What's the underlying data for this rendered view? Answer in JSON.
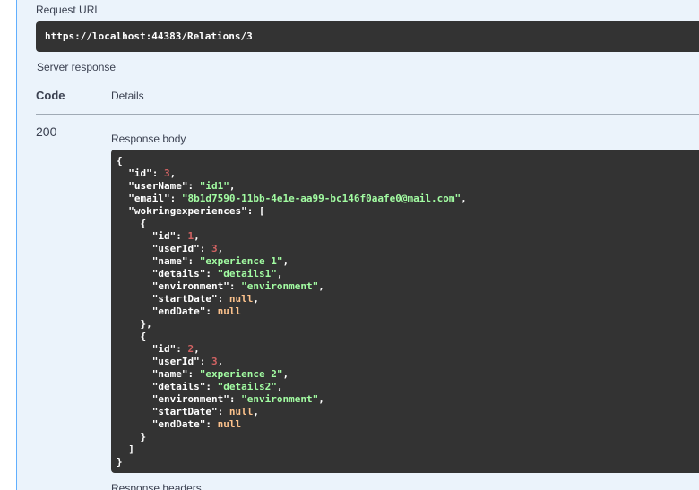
{
  "request_url": {
    "label": "Request URL",
    "value": "https://localhost:44383/Relations/3"
  },
  "server_response": {
    "label": "Server response",
    "headers": {
      "code": "Code",
      "details": "Details"
    },
    "status_code": "200",
    "response_body_label": "Response body",
    "response_headers_label": "Response headers",
    "body": [
      [
        [
          "p",
          "{"
        ]
      ],
      [
        [
          "p",
          "  "
        ],
        [
          "k",
          "\"id\""
        ],
        [
          "p",
          ": "
        ],
        [
          "n",
          "3"
        ],
        [
          "p",
          ","
        ]
      ],
      [
        [
          "p",
          "  "
        ],
        [
          "k",
          "\"userName\""
        ],
        [
          "p",
          ": "
        ],
        [
          "s",
          "\"id1\""
        ],
        [
          "p",
          ","
        ]
      ],
      [
        [
          "p",
          "  "
        ],
        [
          "k",
          "\"email\""
        ],
        [
          "p",
          ": "
        ],
        [
          "s",
          "\"8b1d7590-11bb-4e1e-aa99-bc146f0aafe0@mail.com\""
        ],
        [
          "p",
          ","
        ]
      ],
      [
        [
          "p",
          "  "
        ],
        [
          "k",
          "\"wokringexperiences\""
        ],
        [
          "p",
          ": ["
        ]
      ],
      [
        [
          "p",
          "    {"
        ]
      ],
      [
        [
          "p",
          "      "
        ],
        [
          "k",
          "\"id\""
        ],
        [
          "p",
          ": "
        ],
        [
          "n",
          "1"
        ],
        [
          "p",
          ","
        ]
      ],
      [
        [
          "p",
          "      "
        ],
        [
          "k",
          "\"userId\""
        ],
        [
          "p",
          ": "
        ],
        [
          "n",
          "3"
        ],
        [
          "p",
          ","
        ]
      ],
      [
        [
          "p",
          "      "
        ],
        [
          "k",
          "\"name\""
        ],
        [
          "p",
          ": "
        ],
        [
          "s",
          "\"experience 1\""
        ],
        [
          "p",
          ","
        ]
      ],
      [
        [
          "p",
          "      "
        ],
        [
          "k",
          "\"details\""
        ],
        [
          "p",
          ": "
        ],
        [
          "s",
          "\"details1\""
        ],
        [
          "p",
          ","
        ]
      ],
      [
        [
          "p",
          "      "
        ],
        [
          "k",
          "\"environment\""
        ],
        [
          "p",
          ": "
        ],
        [
          "s",
          "\"environment\""
        ],
        [
          "p",
          ","
        ]
      ],
      [
        [
          "p",
          "      "
        ],
        [
          "k",
          "\"startDate\""
        ],
        [
          "p",
          ": "
        ],
        [
          "l",
          "null"
        ],
        [
          "p",
          ","
        ]
      ],
      [
        [
          "p",
          "      "
        ],
        [
          "k",
          "\"endDate\""
        ],
        [
          "p",
          ": "
        ],
        [
          "l",
          "null"
        ]
      ],
      [
        [
          "p",
          "    },"
        ]
      ],
      [
        [
          "p",
          "    {"
        ]
      ],
      [
        [
          "p",
          "      "
        ],
        [
          "k",
          "\"id\""
        ],
        [
          "p",
          ": "
        ],
        [
          "n",
          "2"
        ],
        [
          "p",
          ","
        ]
      ],
      [
        [
          "p",
          "      "
        ],
        [
          "k",
          "\"userId\""
        ],
        [
          "p",
          ": "
        ],
        [
          "n",
          "3"
        ],
        [
          "p",
          ","
        ]
      ],
      [
        [
          "p",
          "      "
        ],
        [
          "k",
          "\"name\""
        ],
        [
          "p",
          ": "
        ],
        [
          "s",
          "\"experience 2\""
        ],
        [
          "p",
          ","
        ]
      ],
      [
        [
          "p",
          "      "
        ],
        [
          "k",
          "\"details\""
        ],
        [
          "p",
          ": "
        ],
        [
          "s",
          "\"details2\""
        ],
        [
          "p",
          ","
        ]
      ],
      [
        [
          "p",
          "      "
        ],
        [
          "k",
          "\"environment\""
        ],
        [
          "p",
          ": "
        ],
        [
          "s",
          "\"environment\""
        ],
        [
          "p",
          ","
        ]
      ],
      [
        [
          "p",
          "      "
        ],
        [
          "k",
          "\"startDate\""
        ],
        [
          "p",
          ": "
        ],
        [
          "l",
          "null"
        ],
        [
          "p",
          ","
        ]
      ],
      [
        [
          "p",
          "      "
        ],
        [
          "k",
          "\"endDate\""
        ],
        [
          "p",
          ": "
        ],
        [
          "l",
          "null"
        ]
      ],
      [
        [
          "p",
          "    }"
        ]
      ],
      [
        [
          "p",
          "  ]"
        ]
      ],
      [
        [
          "p",
          "}"
        ]
      ]
    ]
  },
  "colors": {
    "panel_bg": "#ebf3fb",
    "code_bg": "#333333",
    "json_string": "#a2fca2",
    "json_number": "#d36363",
    "json_literal": "#fcc28c",
    "accent": "#61affe"
  }
}
